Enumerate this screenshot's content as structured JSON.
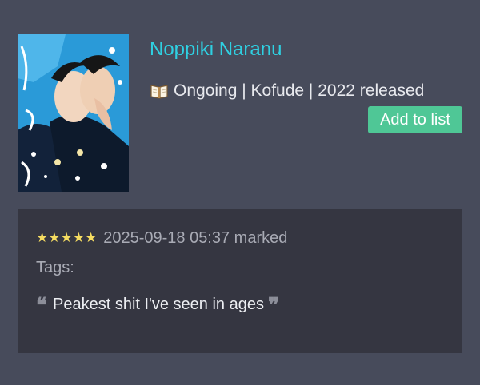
{
  "item": {
    "title": "Noppiki Naranu",
    "status": "Ongoing",
    "separator": " | ",
    "author": "Kofude",
    "released": "2022 released",
    "meta_icon": "book-icon",
    "add_button_label": "Add to list",
    "cover_icon": "manga-cover-image"
  },
  "review": {
    "rating_stars": "★★★★★",
    "rating_value": 5,
    "rating_max": 5,
    "marked_text": "2025-09-18 05:37 marked",
    "tags_label": "Tags:",
    "comment": "Peakest shit I've seen in ages",
    "quote_open": "❝",
    "quote_close": "❞"
  },
  "colors": {
    "background": "#474b5b",
    "card": "#353641",
    "title": "#2fd0e2",
    "button": "#4fc796",
    "stars": "#f5dc61"
  }
}
